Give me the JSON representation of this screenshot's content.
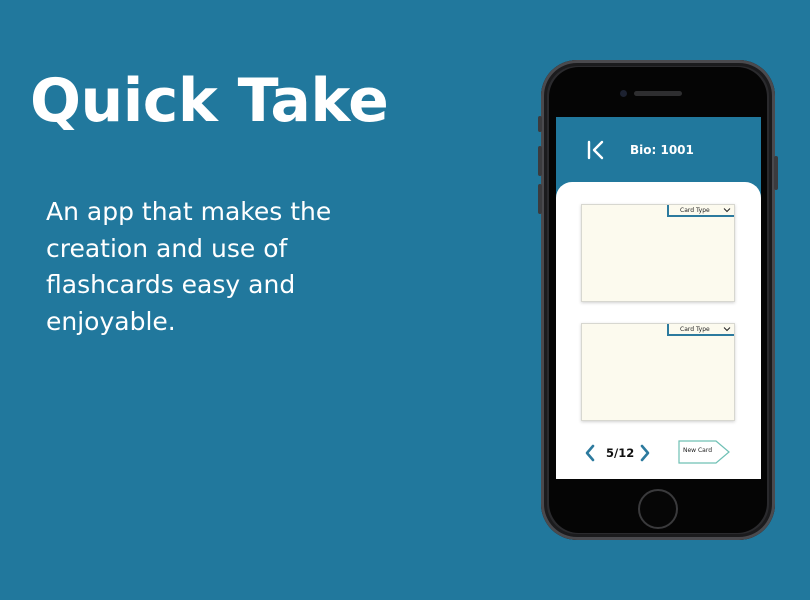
{
  "slide": {
    "headline": "Quick Take",
    "tagline": "An app that makes the creation and use of flashcards easy and enjoyable."
  },
  "app": {
    "header": {
      "back_icon": "back-to-start-icon",
      "deck_title": "Bio: 1001"
    },
    "cards": [
      {
        "type_label": "Card Type",
        "dropdown_icon": "chevron-down-icon"
      },
      {
        "type_label": "Card Type",
        "dropdown_icon": "chevron-down-icon"
      }
    ],
    "pager": {
      "page_label": "5/12",
      "prev_icon": "chevron-left-icon",
      "next_icon": "chevron-right-icon"
    },
    "new_card_label": "New Card"
  },
  "colors": {
    "background": "#21789d",
    "accent": "#2c7a9e",
    "card": "#fcfaee",
    "new_card_outline": "#6fc0b5"
  }
}
